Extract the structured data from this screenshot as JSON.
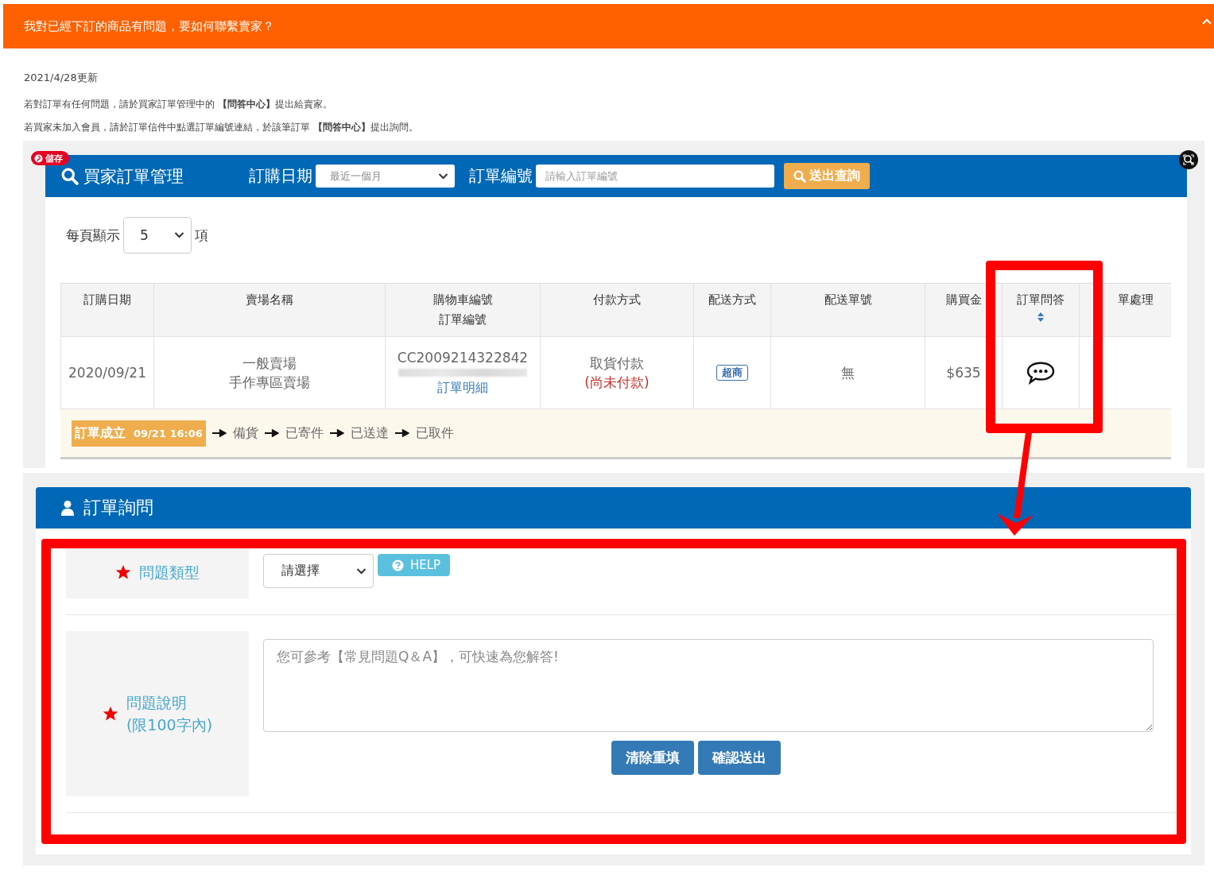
{
  "article_header": {
    "title": "我對已經下訂的商品有問題，要如何聯繫賣家？",
    "expanded": true
  },
  "updated": "2021/4/28更新",
  "paragraphs": [
    "若對訂單有任何問題，請於買家訂單管理中的 **【問答中心】**提出給賣家。",
    "若買家未加入會員，請於訂單信件中點選訂單編號連結，於該筆訂單 **【問答中心】**提出詢問。"
  ],
  "order_screen": {
    "save_badge": "儲存",
    "toolbar": {
      "title": "買家訂單管理",
      "date_label": "訂購日期",
      "date_value": "最近一個月",
      "order_label": "訂單編號",
      "order_placeholder": "請輸入訂單編號",
      "search_button": "送出查詢"
    },
    "page_size": {
      "label": "每頁顯示",
      "value": "5",
      "unit": "項"
    },
    "table": {
      "columns": [
        {
          "lines": [
            "訂購日期"
          ],
          "sortable": false
        },
        {
          "lines": [
            "賣場名稱"
          ],
          "sortable": false
        },
        {
          "lines": [
            "購物車編號",
            "訂單編號"
          ],
          "sortable": false
        },
        {
          "lines": [
            "付款方式"
          ],
          "sortable": false
        },
        {
          "lines": [
            "配送方式"
          ],
          "sortable": false
        },
        {
          "lines": [
            "配送單號"
          ],
          "sortable": false
        },
        {
          "lines": [
            "購買金"
          ],
          "sortable": false
        },
        {
          "lines": [
            "訂單問答"
          ],
          "sortable": true
        },
        {
          "lines": [
            "單處理"
          ],
          "sortable": false
        }
      ],
      "rows": [
        {
          "date": "2020/09/21",
          "stores": [
            "一般賣場",
            "手作專區賣場"
          ],
          "cart_no": "CC2009214322842",
          "detail_link": "訂單明細",
          "payment": "取貨付款",
          "payment_status": "(尚未付款)",
          "shipping": "超商",
          "tracking": "無",
          "amount": "$635"
        }
      ]
    },
    "progress": [
      {
        "label": "訂單成立",
        "time": "09/21 16:06",
        "current": true
      },
      {
        "label": "備貨",
        "current": false
      },
      {
        "label": "已寄件",
        "current": false
      },
      {
        "label": "已送達",
        "current": false
      },
      {
        "label": "已取件",
        "current": false
      }
    ]
  },
  "inquiry": {
    "title": "訂單詢問",
    "fields": [
      {
        "kind": "select",
        "label": "問題類型",
        "required": true,
        "value": "請選擇",
        "help": "HELP"
      },
      {
        "kind": "textarea",
        "label": "問題說明",
        "note": "(限100字內)",
        "required": true,
        "placeholder": "您可參考【常見問題Q＆A】，可快速為您解答!"
      }
    ],
    "buttons": [
      "清除重填",
      "確認送出"
    ]
  }
}
